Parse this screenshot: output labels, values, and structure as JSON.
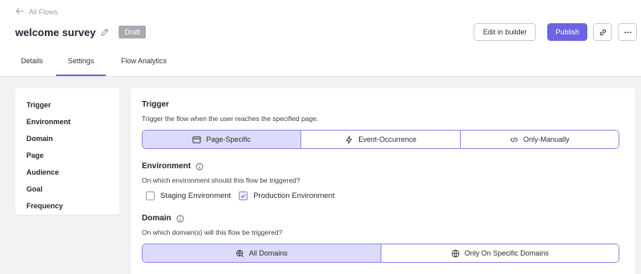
{
  "header": {
    "back_label": "All Flows",
    "title": "welcome survey",
    "status_badge": "Draft"
  },
  "actions": {
    "edit_in_builder": "Edit in builder",
    "publish": "Publish"
  },
  "tabs": [
    {
      "label": "Details",
      "active": false
    },
    {
      "label": "Settings",
      "active": true
    },
    {
      "label": "Flow Analytics",
      "active": false
    }
  ],
  "sidebar": {
    "items": [
      {
        "label": "Trigger"
      },
      {
        "label": "Environment"
      },
      {
        "label": "Domain"
      },
      {
        "label": "Page"
      },
      {
        "label": "Audience"
      },
      {
        "label": "Goal"
      },
      {
        "label": "Frequency"
      }
    ]
  },
  "trigger": {
    "title": "Trigger",
    "description": "Trigger the flow when the user reaches the specified page.",
    "options": [
      {
        "label": "Page-Specific",
        "icon": "browser-window-icon",
        "selected": true
      },
      {
        "label": "Event-Occurrence",
        "icon": "lightning-icon",
        "selected": false
      },
      {
        "label": "Only-Manually",
        "icon": "code-icon",
        "selected": false
      }
    ]
  },
  "environment": {
    "title": "Environment",
    "description": "On which environment should this flow be triggered?",
    "options": [
      {
        "label": "Staging Environment",
        "checked": false
      },
      {
        "label": "Production Environment",
        "checked": true
      }
    ]
  },
  "domain": {
    "title": "Domain",
    "description": "On which domain(s) will this flow be triggered?",
    "options": [
      {
        "label": "All Domains",
        "icon": "globe-search-icon",
        "selected": true
      },
      {
        "label": "Only On Specific Domains",
        "icon": "globe-icon",
        "selected": false
      }
    ]
  },
  "colors": {
    "accent": "#6e64e1",
    "selected_fill": "#dcdbfb",
    "content_bg": "#f1f2f4",
    "badge_bg": "#a8aab0"
  }
}
